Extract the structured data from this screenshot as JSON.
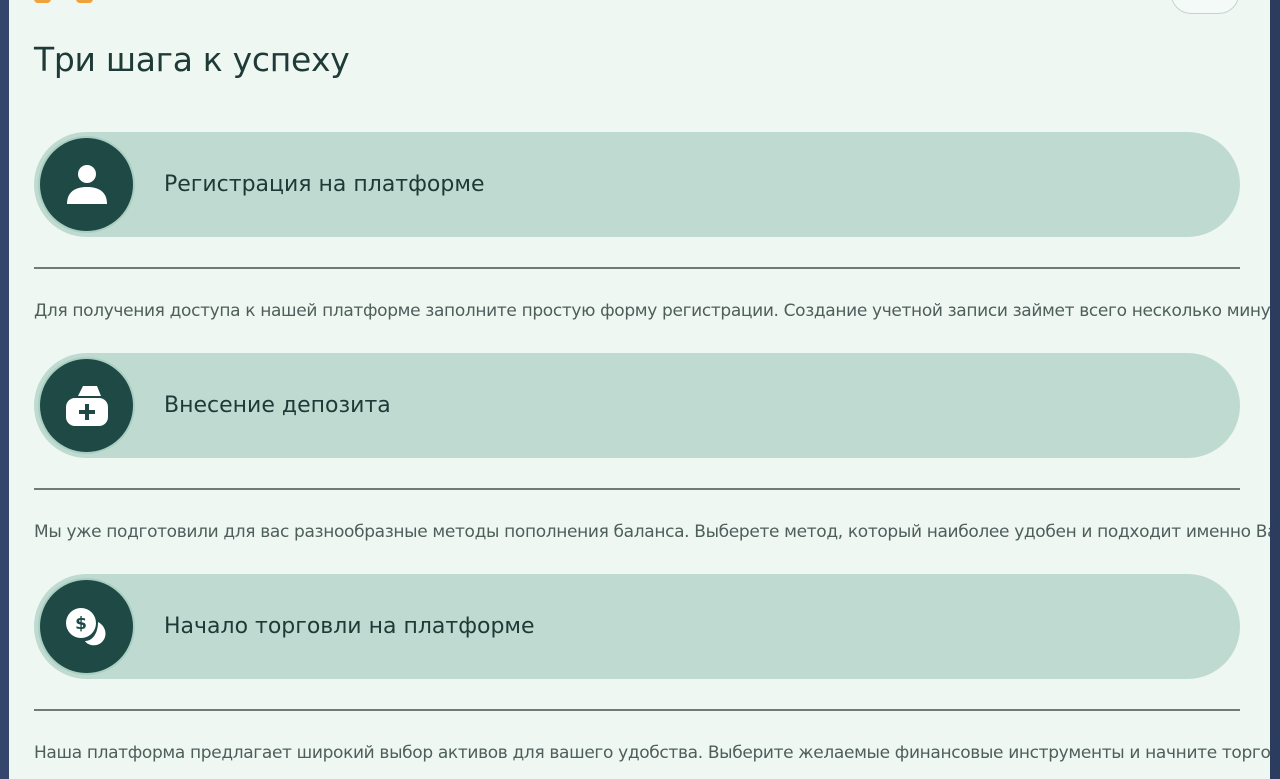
{
  "section": {
    "title": "Три шага к успеху"
  },
  "steps": [
    {
      "label": "Регистрация на платформе",
      "icon": "user-icon",
      "description": "Для получения доступа к нашей платформе заполните простую форму регистрации. Создание учетной записи займет всего несколько минут."
    },
    {
      "label": "Внесение депозита",
      "icon": "wallet-plus-icon",
      "description": "Мы уже подготовили для вас разнообразные методы пополнения баланса. Выберете метод, который наиболее удобен и подходит именно Вам."
    },
    {
      "label": "Начало торговли на платформе",
      "icon": "coin-dollar-icon",
      "description": "Наша платформа предлагает широкий выбор активов для вашего удобства. Выберите желаемые финансовые инструменты и начните торговать."
    }
  ],
  "colors": {
    "page_background": "#eff7f3",
    "step_bar": "#bfdbd1",
    "icon_circle": "#1e4944",
    "title_text": "#1f3b37",
    "description_text": "#4d5e5b",
    "accent_logo": "#f0a23a"
  }
}
